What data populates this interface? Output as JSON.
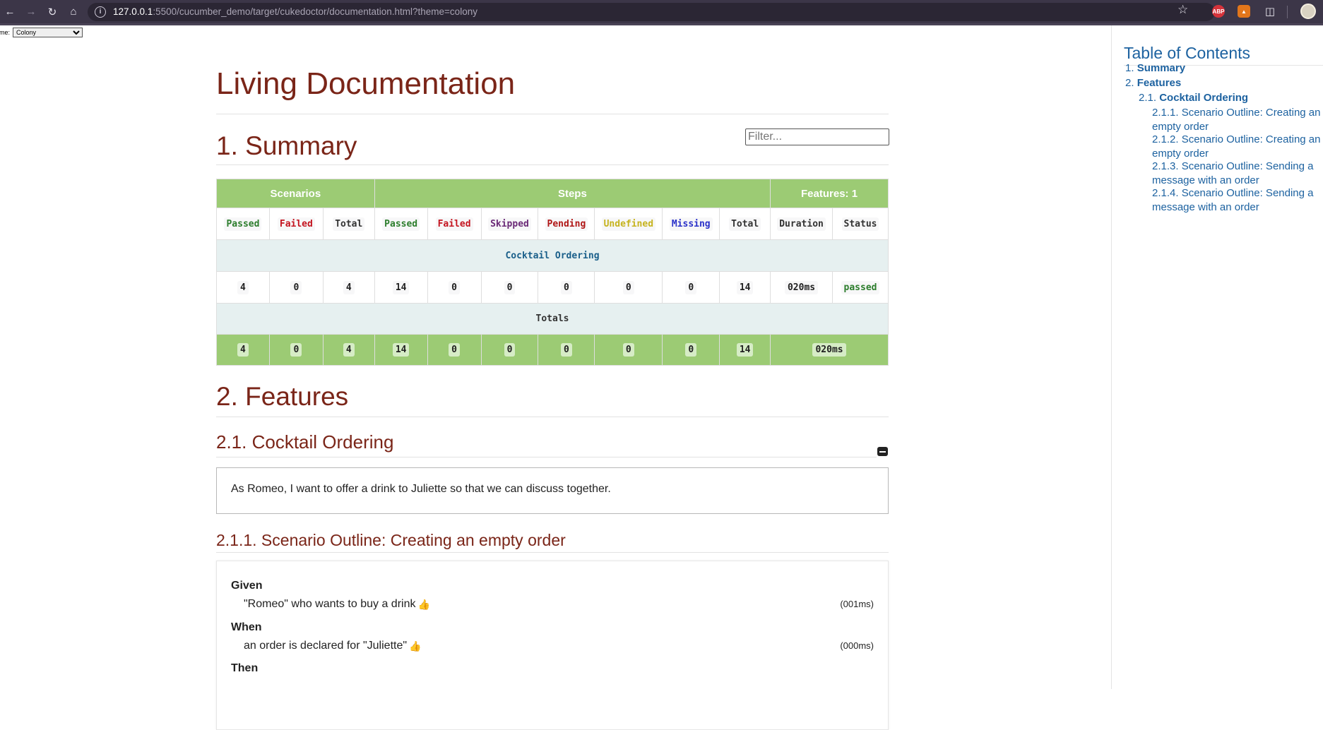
{
  "browser": {
    "url_host": "127.0.0.1",
    "url_rest": ":5500/cucumber_demo/target/cukedoctor/documentation.html?theme=colony"
  },
  "theme": {
    "label": "eme:",
    "selected": "Colony"
  },
  "page": {
    "title": "Living Documentation",
    "filter_placeholder": "Filter...",
    "summary_heading": "1. Summary",
    "features_heading": "2. Features",
    "feature_heading": "2.1. Cocktail Ordering",
    "feature_description": "As Romeo, I want to offer a drink to Juliette so that we can discuss together.",
    "scenario_heading": "2.1.1. Scenario Outline: Creating an empty order"
  },
  "summary_table": {
    "group_headers": [
      "Scenarios",
      "Steps",
      "Features: 1"
    ],
    "columns": [
      "Passed",
      "Failed",
      "Total",
      "Passed",
      "Failed",
      "Skipped",
      "Pending",
      "Undefined",
      "Missing",
      "Total",
      "Duration",
      "Status"
    ],
    "feature_name": "Cocktail Ordering",
    "feature_values": [
      "4",
      "0",
      "4",
      "14",
      "0",
      "0",
      "0",
      "0",
      "0",
      "14",
      "020ms",
      "passed"
    ],
    "totals_label": "Totals",
    "totals_values": [
      "4",
      "0",
      "4",
      "14",
      "0",
      "0",
      "0",
      "0",
      "0",
      "14",
      "020ms"
    ]
  },
  "scenario": {
    "steps": [
      {
        "keyword": "Given",
        "text": "\"Romeo\" who wants to buy a drink",
        "duration": "(001ms)"
      },
      {
        "keyword": "When",
        "text": "an order is declared for \"Juliette\"",
        "duration": "(000ms)"
      },
      {
        "keyword": "Then",
        "text": "",
        "duration": ""
      }
    ]
  },
  "toc": {
    "title": "Table of Contents",
    "items": [
      {
        "num": "1.",
        "label": "Summary"
      },
      {
        "num": "2.",
        "label": "Features"
      },
      {
        "num": "2.1.",
        "label": "Cocktail Ordering"
      },
      {
        "num": "2.1.1.",
        "label_line1": "Scenario Outline: Creating an",
        "label_line2": "empty order"
      },
      {
        "num": "2.1.2.",
        "label_line1": "Scenario Outline: Creating an",
        "label_line2": "empty order"
      },
      {
        "num": "2.1.3.",
        "label_line1": "Scenario Outline: Sending a",
        "label_line2": "message with an order"
      },
      {
        "num": "2.1.4.",
        "label_line1": "Scenario Outline: Sending a",
        "label_line2": "message with an order"
      }
    ]
  },
  "colors": {
    "heading": "#7a2518",
    "table_header": "#9ccb74",
    "link": "#1d62a0"
  }
}
